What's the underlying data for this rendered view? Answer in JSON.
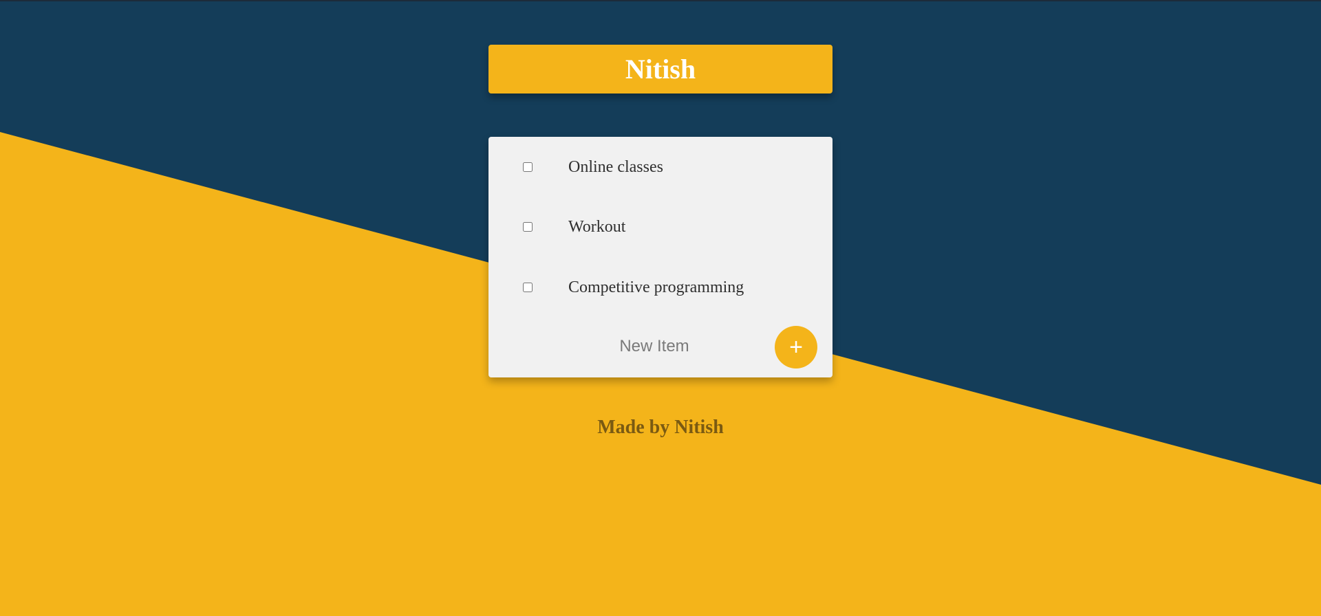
{
  "header": {
    "title": "Nitish"
  },
  "todo": {
    "items": [
      {
        "label": "Online classes",
        "checked": false
      },
      {
        "label": "Workout",
        "checked": false
      },
      {
        "label": "Competitive programming",
        "checked": false
      }
    ],
    "new_item": {
      "placeholder": "New Item",
      "value": ""
    },
    "add_button_label": "+"
  },
  "footer": {
    "text": "Made by Nitish"
  },
  "colors": {
    "navy": "#143d59",
    "yellow": "#f4b41a",
    "card": "#f1f1f1"
  },
  "icons": {
    "add": "plus-icon"
  }
}
